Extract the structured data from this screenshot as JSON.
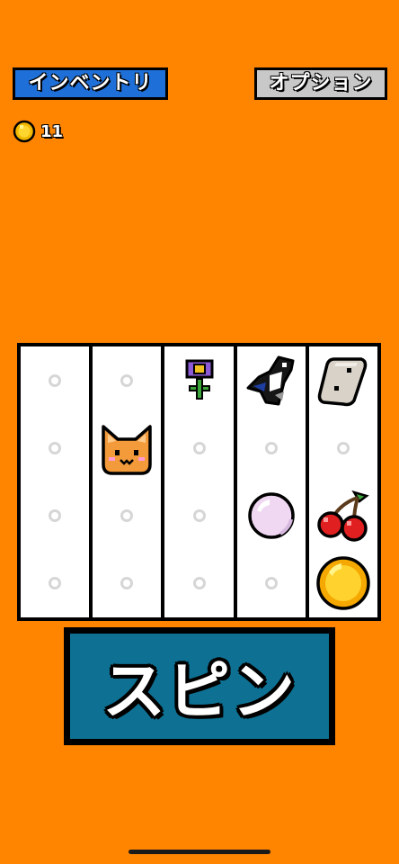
{
  "header": {
    "inventory_label": "インベントリ",
    "options_label": "オプション"
  },
  "coins": {
    "icon": "coin-icon",
    "count": "11"
  },
  "reels": [
    [
      "empty",
      "empty",
      "empty",
      "empty"
    ],
    [
      "empty",
      "cat",
      "empty",
      "empty"
    ],
    [
      "flower",
      "empty",
      "empty",
      "empty"
    ],
    [
      "magpie",
      "empty",
      "pearl",
      "empty"
    ],
    [
      "rock",
      "empty",
      "cherry",
      "coin"
    ]
  ],
  "spin": {
    "label": "スピン"
  },
  "colors": {
    "background": "#ff8400",
    "inventory_button": "#1f6fd8",
    "options_button": "#c8c8c8",
    "spin_button": "#0e7193"
  }
}
